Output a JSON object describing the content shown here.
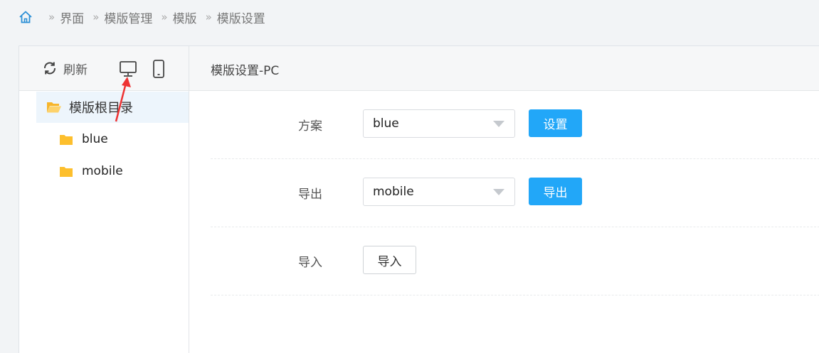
{
  "breadcrumb": {
    "items": [
      "界面",
      "模版管理",
      "模版",
      "模版设置"
    ],
    "separator": "»"
  },
  "sidebar": {
    "refresh_label": "刷新",
    "tree": {
      "root_label": "模版根目录",
      "children": [
        "blue",
        "mobile"
      ]
    }
  },
  "content": {
    "title": "模版设置-PC",
    "rows": [
      {
        "label": "方案",
        "select_value": "blue",
        "button_label": "设置"
      },
      {
        "label": "导出",
        "select_value": "mobile",
        "button_label": "导出"
      },
      {
        "label": "导入",
        "button_label": "导入"
      }
    ]
  },
  "colors": {
    "accent": "#22a7f8",
    "folder": "#fdbf2d",
    "annotation_arrow": "#ee3333"
  },
  "icons": [
    "home-icon",
    "refresh-icon",
    "desktop-icon",
    "mobile-phone-icon",
    "folder-open-icon",
    "folder-icon",
    "annotation-arrow"
  ]
}
